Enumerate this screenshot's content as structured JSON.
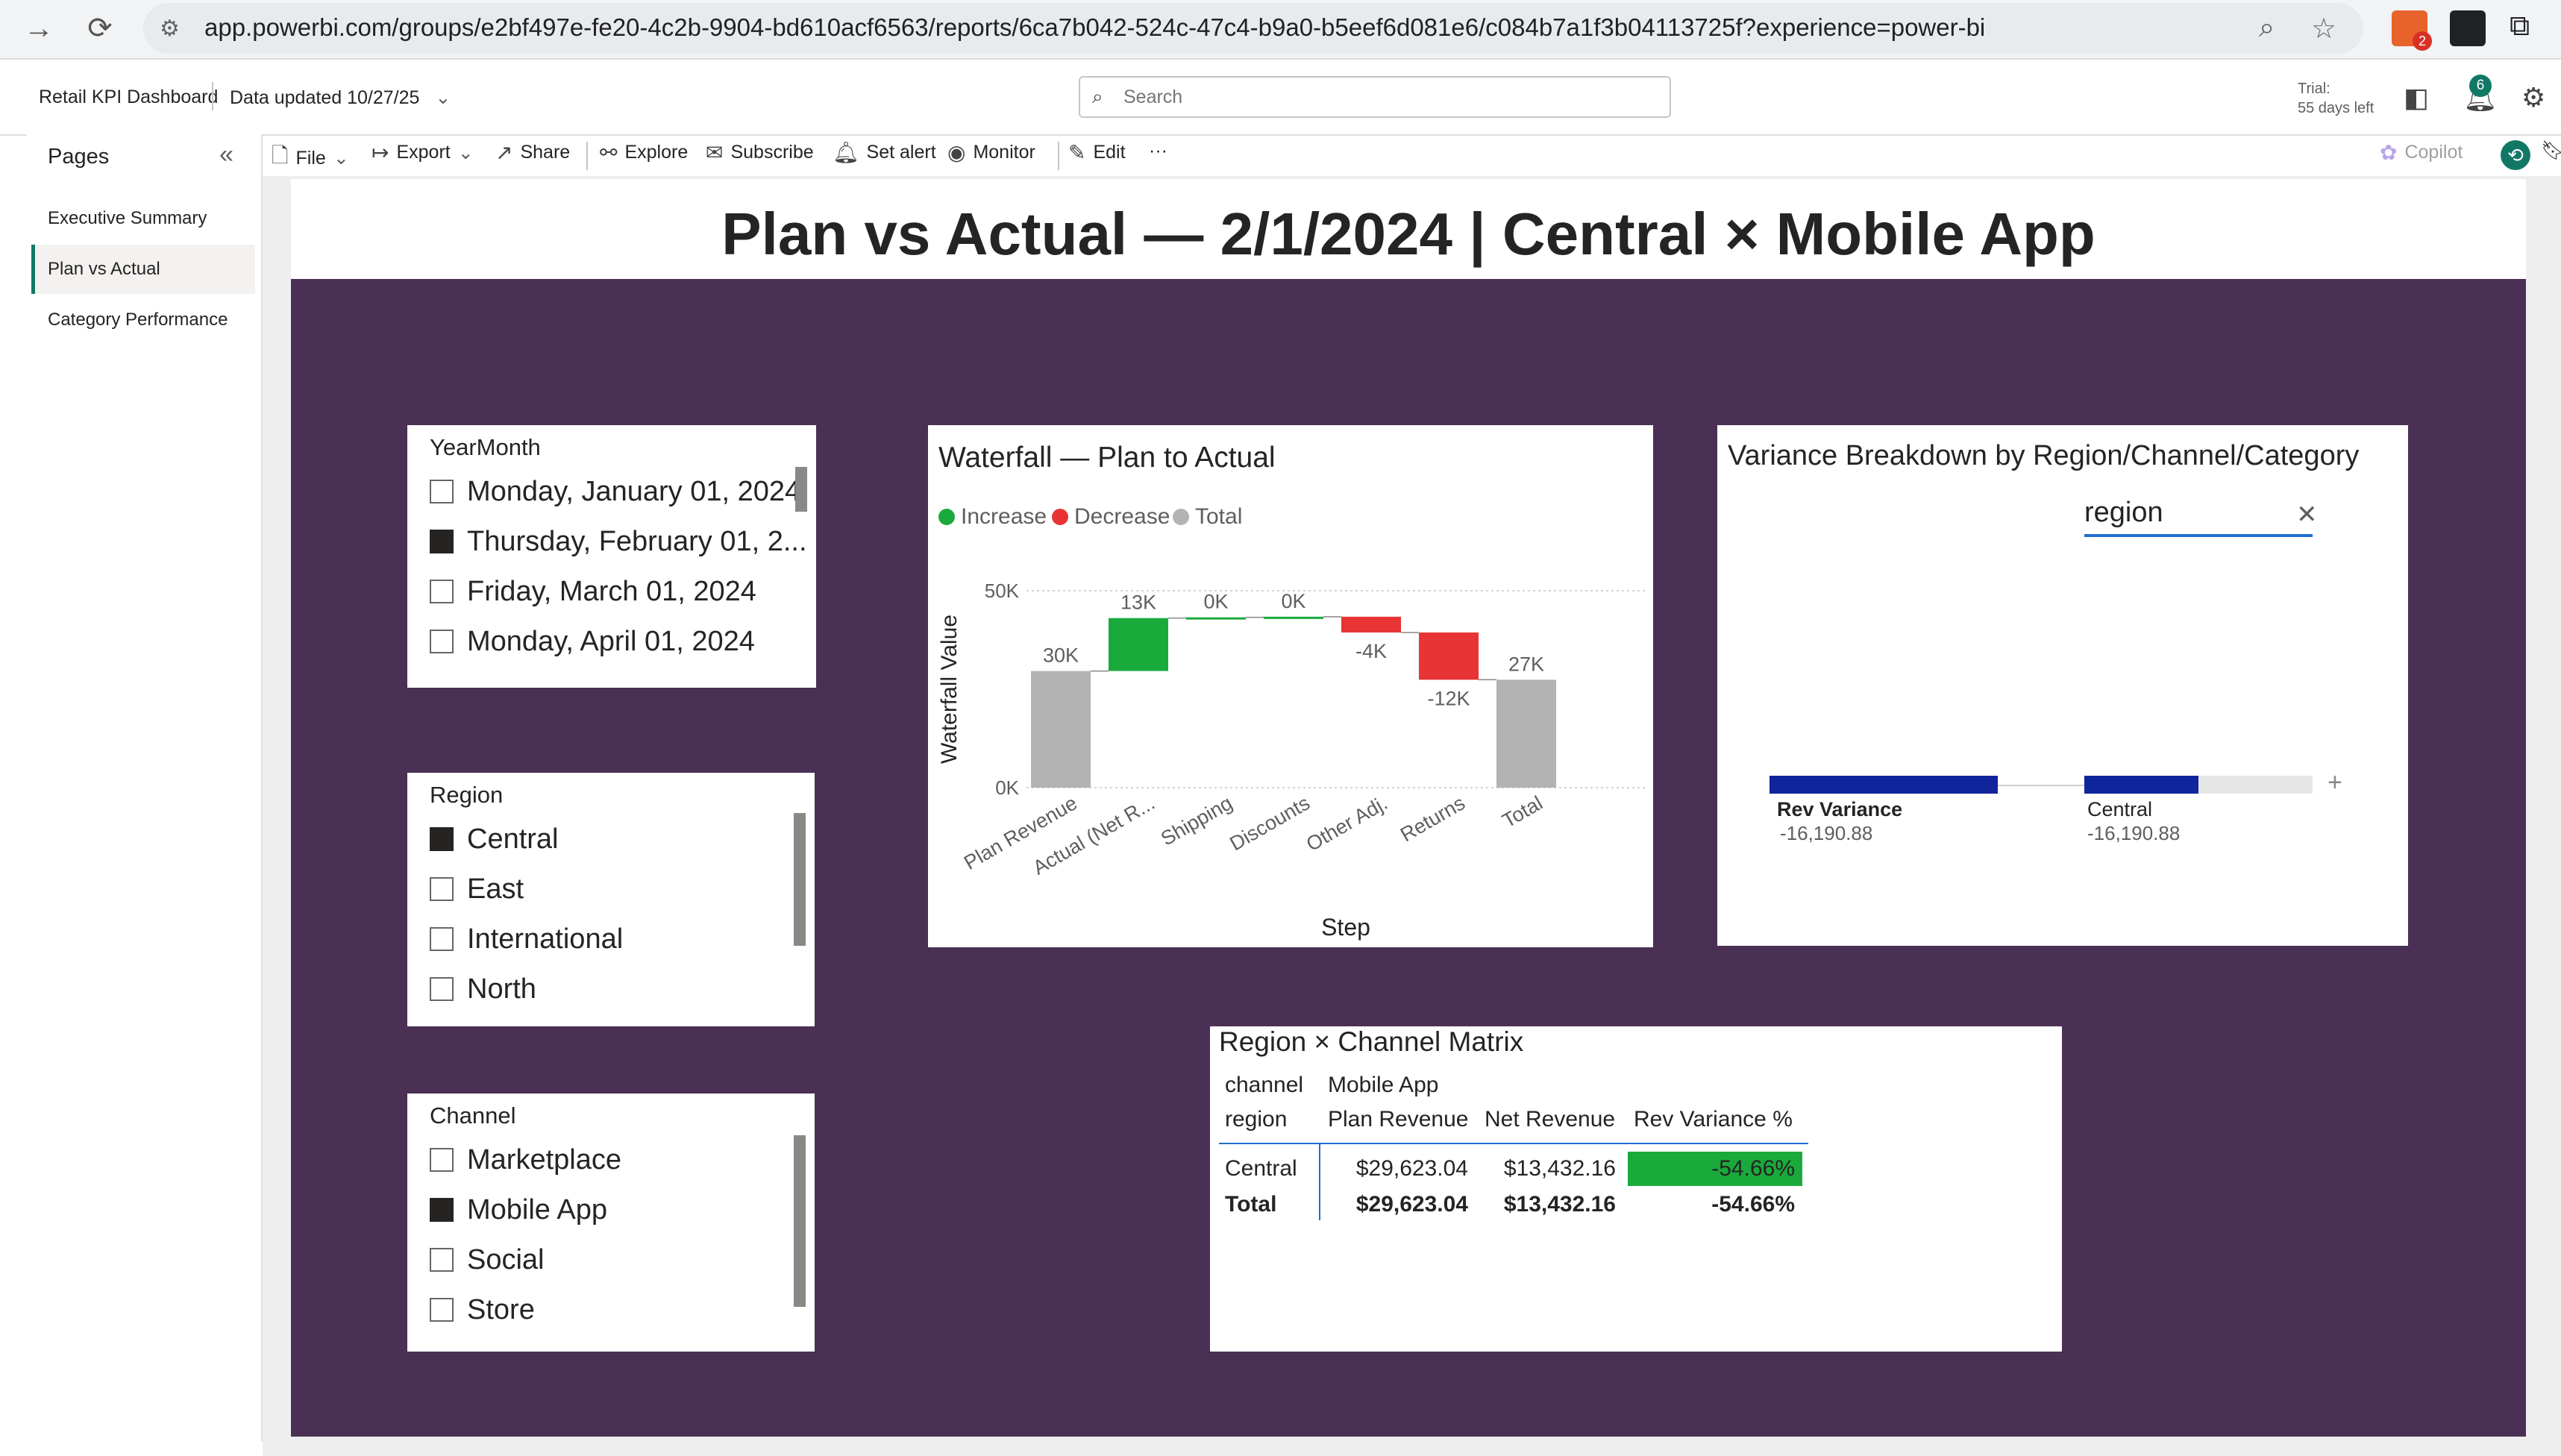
{
  "browser": {
    "url": "app.powerbi.com/groups/e2bf497e-fe20-4c2b-9904-bd610acf6563/reports/6ca7b042-524c-47c4-b9a0-b5eef6d081e6/c084b7a1f3b04113725f?experience=power-bi",
    "ext_badge": "2"
  },
  "header": {
    "report_name": "Retail KPI Dashboard",
    "data_updated": "Data updated 10/27/25",
    "search_placeholder": "Search",
    "trial_line1": "Trial:",
    "trial_line2": "55 days left",
    "notification_count": "6"
  },
  "pages_pane": {
    "title": "Pages",
    "items": [
      {
        "label": "Executive Summary"
      },
      {
        "label": "Plan vs Actual"
      },
      {
        "label": "Category Performance"
      }
    ]
  },
  "toolbar": {
    "file": "File",
    "export": "Export",
    "share": "Share",
    "explore": "Explore",
    "subscribe": "Subscribe",
    "set_alert": "Set alert",
    "monitor": "Monitor",
    "edit": "Edit",
    "more": "···",
    "copilot": "Copilot"
  },
  "report": {
    "title": "Plan vs Actual — 2/1/2024 | Central × Mobile App"
  },
  "slicers": {
    "yearmonth": {
      "title": "YearMonth",
      "items": [
        {
          "label": "Monday, January 01, 2024",
          "checked": false
        },
        {
          "label": "Thursday, February 01, 2...",
          "checked": true
        },
        {
          "label": "Friday, March 01, 2024",
          "checked": false
        },
        {
          "label": "Monday, April 01, 2024",
          "checked": false
        }
      ]
    },
    "region": {
      "title": "Region",
      "items": [
        {
          "label": "Central",
          "checked": true
        },
        {
          "label": "East",
          "checked": false
        },
        {
          "label": "International",
          "checked": false
        },
        {
          "label": "North",
          "checked": false
        }
      ]
    },
    "channel": {
      "title": "Channel",
      "items": [
        {
          "label": "Marketplace",
          "checked": false
        },
        {
          "label": "Mobile App",
          "checked": true
        },
        {
          "label": "Social",
          "checked": false
        },
        {
          "label": "Store",
          "checked": false
        }
      ]
    }
  },
  "waterfall": {
    "title": "Waterfall — Plan to Actual",
    "legend": [
      "Increase",
      "Decrease",
      "Total"
    ]
  },
  "decomp": {
    "title": "Variance Breakdown by Region/Channel/Category",
    "level_label": "region",
    "root_label": "Rev Variance",
    "root_value": "-16,190.88",
    "node_label": "Central",
    "node_value": "-16,190.88",
    "bar_fill": 0.5
  },
  "matrix": {
    "title": "Region × Channel Matrix",
    "col_header_field": "channel",
    "col_header_value": "Mobile App",
    "row_header_field": "region",
    "measures": [
      "Plan Revenue",
      "Net Revenue",
      "Rev Variance %"
    ],
    "rows": [
      {
        "label": "Central",
        "plan": "$29,623.04",
        "net": "$13,432.16",
        "var": "-54.66%"
      }
    ],
    "total": {
      "label": "Total",
      "plan": "$29,623.04",
      "net": "$13,432.16",
      "var": "-54.66%"
    }
  },
  "colors": {
    "increase": "#1aaa3c",
    "decrease": "#e83434",
    "total": "#b3b3b3",
    "page_background": "#4a3054",
    "accent": "#117865",
    "decomp_bar": "#10249c",
    "matrix_highlight": "#1aaa3c"
  },
  "chart_data": {
    "type": "bar",
    "title": "Waterfall — Plan to Actual",
    "xlabel": "Step",
    "ylabel": "Waterfall Value",
    "ylim": [
      0,
      50000
    ],
    "y_ticks": [
      "0K",
      "50K"
    ],
    "categories": [
      "Plan Revenue",
      "Actual (Net R...",
      "Shipping",
      "Discounts",
      "Other Adj.",
      "Returns",
      "Total"
    ],
    "kind": [
      "total",
      "increase",
      "increase",
      "increase",
      "decrease",
      "decrease",
      "total"
    ],
    "values": [
      29623,
      13432,
      200,
      150,
      -4000,
      -12000,
      27405
    ],
    "data_labels": [
      "30K",
      "13K",
      "0K",
      "0K",
      "-4K",
      "-12K",
      "27K"
    ],
    "legend": [
      "Increase",
      "Decrease",
      "Total"
    ],
    "legend_position": "top-left",
    "grid": true
  }
}
